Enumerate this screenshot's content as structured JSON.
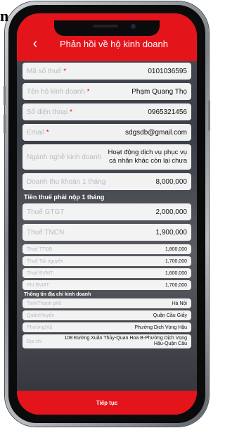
{
  "corner_glyph": "n",
  "header": {
    "title": "Phản hồi về hộ kinh doanh",
    "back_icon": "chevron-left-icon"
  },
  "fields": [
    {
      "label": "Mã số thuế",
      "required": "*",
      "value": "0101036595"
    },
    {
      "label": "Tên hộ kinh doanh",
      "required": "*",
      "value": "Phạm Quang Thọ"
    },
    {
      "label": "Số điện thoại",
      "required": "*",
      "value": "0965321456"
    },
    {
      "label": "Email",
      "required": "*",
      "value": "sdgsdb@gmail.com"
    },
    {
      "label": "Ngành nghề kinh doanh",
      "required": "",
      "value": "Hoạt động dịch vụ phục vụ cá nhân khác còn lại chưa"
    },
    {
      "label": "Doanh thu khoán 1 tháng",
      "required": "",
      "value": "8,000,000"
    }
  ],
  "tax_section": {
    "title": "Tiền thuế phải nộp 1 tháng",
    "items": [
      {
        "label": "Thuế GTGT",
        "value": "2,000,000"
      },
      {
        "label": "Thuế TNCN",
        "value": "1,900,000"
      },
      {
        "label": "Thuế TTĐB",
        "value": "1,800,000"
      },
      {
        "label": "Thuế Tài nguyên",
        "value": "1,700,000"
      },
      {
        "label": "Thuế BVMT",
        "value": "1,600,000"
      },
      {
        "label": "Phí BVMT",
        "value": "1,700,000"
      }
    ]
  },
  "address_section": {
    "title": "Thông tin địa chỉ kinh doanh",
    "items": [
      {
        "label": "Tỉnh/Thành phố",
        "value": "Hà Nội"
      },
      {
        "label": "Quận/Huyện",
        "value": "Quận Cầu Giấy"
      },
      {
        "label": "Phường/Xã",
        "value": "Phường Dịch Vọng Hậu"
      },
      {
        "label": "Địa chỉ",
        "value": "108 Đường Xuân Thủy-Quan Hoa B-Phường Dịch Vọng Hậu-Quận Cầu"
      }
    ]
  },
  "footer": {
    "button_label": "Tiếp tục"
  },
  "colors": {
    "accent": "#e4141b"
  }
}
